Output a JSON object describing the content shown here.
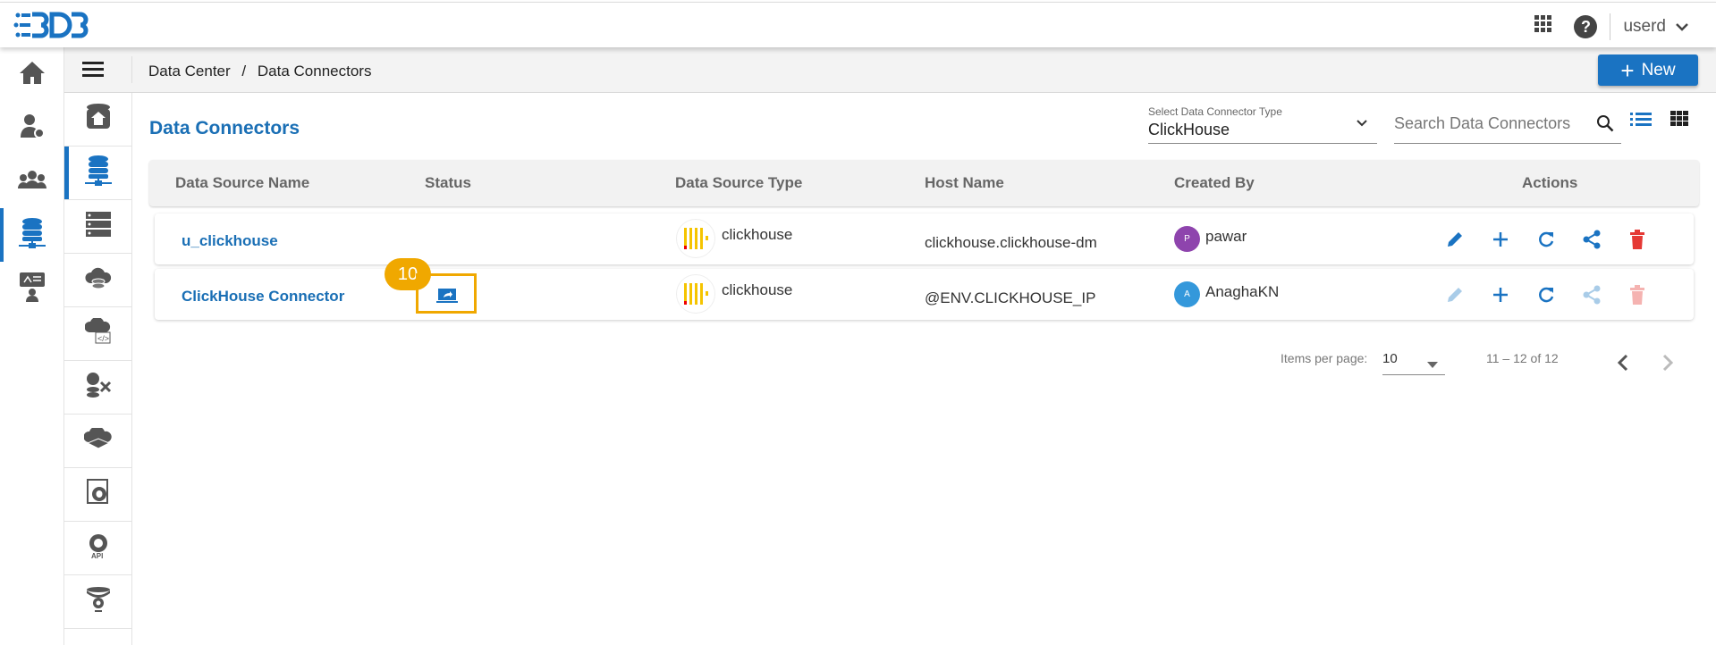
{
  "header": {
    "logo_text": "BDB",
    "user": "userd"
  },
  "breadcrumb": {
    "parent": "Data Center",
    "separator": "/",
    "current": "Data Connectors"
  },
  "toolbar": {
    "new_label": "New"
  },
  "page": {
    "title": "Data Connectors"
  },
  "filter": {
    "label": "Select Data Connector Type",
    "value": "ClickHouse"
  },
  "search": {
    "placeholder": "Search Data Connectors"
  },
  "table": {
    "headers": [
      "Data Source Name",
      "Status",
      "Data Source Type",
      "Host Name",
      "Created By",
      "Actions"
    ],
    "rows": [
      {
        "name": "u_clickhouse",
        "type": "clickhouse",
        "host": "clickhouse.clickhouse-dm",
        "creator": "pawar",
        "initial": "P",
        "avatar_color": "#8e44ad",
        "actions_enabled": true
      },
      {
        "name": "ClickHouse Connector",
        "type": "clickhouse",
        "host": "@ENV.CLICKHOUSE_IP",
        "creator": "AnaghaKN",
        "initial": "A",
        "avatar_color": "#3498db",
        "actions_enabled": false
      }
    ]
  },
  "callout": {
    "number": "10"
  },
  "pagination": {
    "label": "Items per page:",
    "per_page": "10",
    "range": "11 – 12 of 12"
  },
  "colors": {
    "accent": "#1a73c2",
    "callout": "#f0a800",
    "delete": "#e53935"
  }
}
